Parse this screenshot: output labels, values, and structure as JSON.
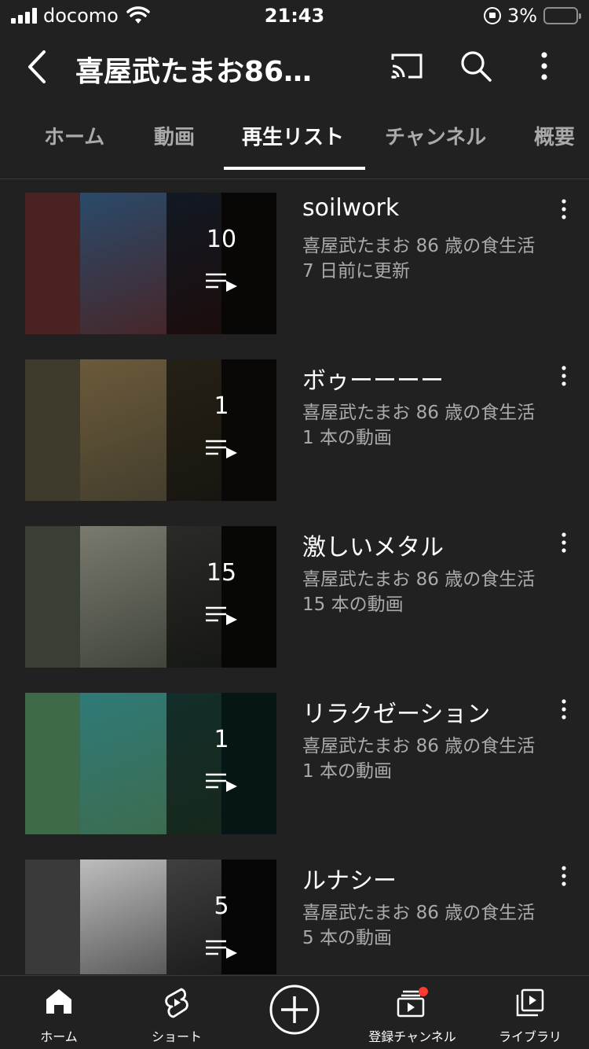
{
  "status_bar": {
    "carrier": "docomo",
    "time": "21:43",
    "battery_percent": "3%",
    "battery_level": 0.03
  },
  "header": {
    "title": "喜屋武たまお86…",
    "icons": [
      "back-icon",
      "cast-icon",
      "search-icon",
      "more-vert-icon"
    ]
  },
  "tabs": [
    {
      "label": "ホーム",
      "active": false
    },
    {
      "label": "動画",
      "active": false
    },
    {
      "label": "再生リスト",
      "active": true
    },
    {
      "label": "チャンネル",
      "active": false
    },
    {
      "label": "概要",
      "active": false
    }
  ],
  "playlists": [
    {
      "title": "soilwork",
      "channel": "喜屋武たまお 86 歳の食生活",
      "meta": "7 日前に更新",
      "count": "10",
      "colors": {
        "side": "#4a2222",
        "art": "#2a4a6a",
        "right": "#1a1010"
      }
    },
    {
      "title": "ボゥーーーー",
      "channel": "喜屋武たまお 86 歳の食生活",
      "meta": "1 本の動画",
      "count": "1",
      "colors": {
        "side": "#3f3b2c",
        "art": "#6b5a3a",
        "right": "#181710"
      }
    },
    {
      "title": "激しいメタル",
      "channel": "喜屋武たまお 86 歳の食生活",
      "meta": "15 本の動画",
      "count": "15",
      "colors": {
        "side": "#3a3f36",
        "art": "#7a7a6e",
        "right": "#141512"
      }
    },
    {
      "title": "リラクゼーション",
      "channel": "喜屋武たまお 86 歳の食生活",
      "meta": "1 本の動画",
      "count": "1",
      "colors": {
        "side": "#3e6a4a",
        "art": "#2f7a78",
        "right": "#0e3a36"
      }
    },
    {
      "title": "ルナシー",
      "channel": "喜屋武たまお 86 歳の食生活",
      "meta": "5 本の動画",
      "count": "5",
      "colors": {
        "side": "#3a3a3a",
        "art": "#bdbdbd",
        "right": "#111111"
      }
    }
  ],
  "bottom_nav": [
    {
      "label": "ホーム",
      "icon": "home-icon"
    },
    {
      "label": "ショート",
      "icon": "shorts-icon"
    },
    {
      "label": "",
      "icon": "create-icon"
    },
    {
      "label": "登録チャンネル",
      "icon": "subscriptions-icon",
      "badge": true
    },
    {
      "label": "ライブラリ",
      "icon": "library-icon"
    }
  ],
  "colors": {
    "background": "#212121",
    "text_secondary": "#aaaaaa",
    "badge": "#ff3b30",
    "battery_low": "#f5c400"
  }
}
